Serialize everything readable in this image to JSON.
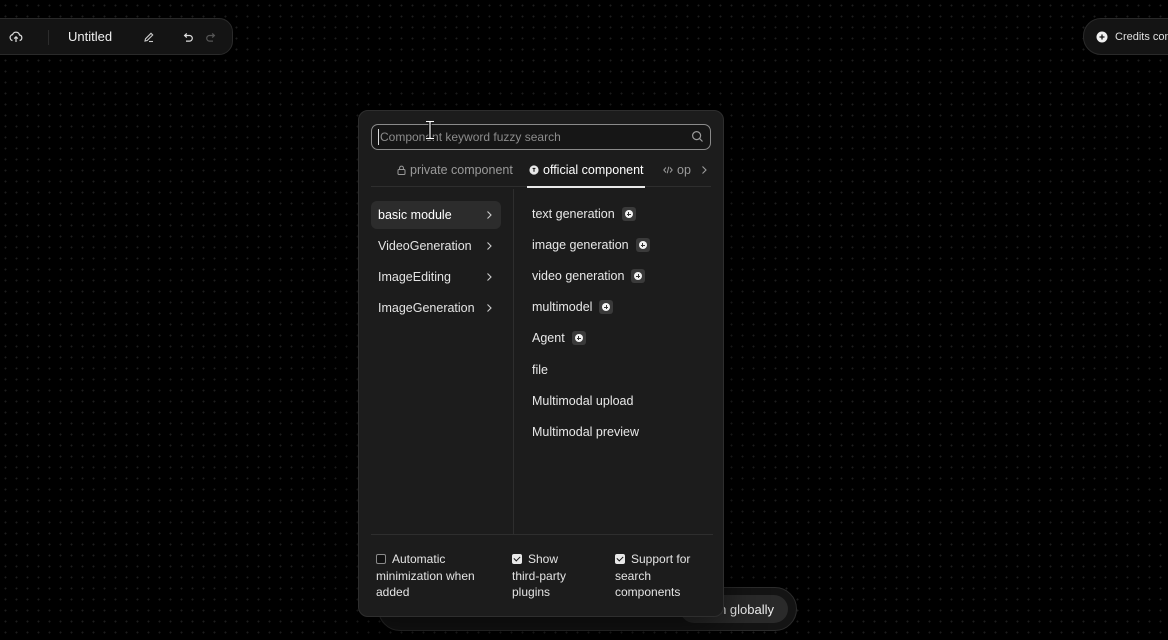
{
  "toolbar": {
    "title": "Untitled"
  },
  "credits": {
    "label": "Credits cons"
  },
  "runbar": {
    "run_label": "Run globally"
  },
  "panel": {
    "search": {
      "placeholder": "Component keyword fuzzy search"
    },
    "tabs": [
      {
        "label": "private component",
        "icon": "lock-icon"
      },
      {
        "label": "official component",
        "icon": "official-badge-icon",
        "active": true
      },
      {
        "label": "op",
        "icon": "code-icon"
      }
    ],
    "categories": [
      {
        "label": "basic module",
        "active": true
      },
      {
        "label": "VideoGeneration"
      },
      {
        "label": "ImageEditing"
      },
      {
        "label": "ImageGeneration"
      }
    ],
    "items": [
      {
        "label": "text generation",
        "badge": true
      },
      {
        "label": "image generation",
        "badge": true
      },
      {
        "label": "video generation",
        "badge": true
      },
      {
        "label": "multimodel",
        "badge": true
      },
      {
        "label": "Agent",
        "badge": true
      },
      {
        "label": "file",
        "badge": false
      },
      {
        "label": "Multimodal upload",
        "badge": false
      },
      {
        "label": "Multimodal preview",
        "badge": false
      }
    ],
    "options": {
      "auto_minimize": {
        "lines": [
          "Automatic",
          "minimization when",
          "added"
        ],
        "checked": false
      },
      "third_party": {
        "lines": [
          "Show",
          "third-party",
          "plugins"
        ],
        "checked": true
      },
      "search_components": {
        "lines": [
          "Support for",
          "search",
          "components"
        ],
        "checked": true
      }
    }
  }
}
